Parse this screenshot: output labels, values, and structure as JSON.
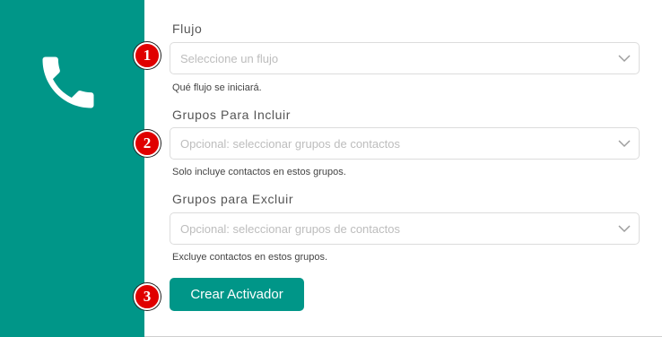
{
  "sidebar": {
    "icon": "phone-icon",
    "color": "#009688"
  },
  "form": {
    "flow": {
      "label": "Flujo",
      "placeholder": "Seleccione un flujo",
      "help": "Qué flujo se iniciará."
    },
    "include_groups": {
      "label": "Grupos Para Incluir",
      "placeholder": "Opcional: seleccionar grupos de contactos",
      "help": "Solo incluye contactos en estos grupos."
    },
    "exclude_groups": {
      "label": "Grupos para Excluir",
      "placeholder": "Opcional: seleccionar grupos de contactos",
      "help": "Excluye contactos en estos grupos."
    },
    "submit_label": "Crear Activador"
  },
  "markers": [
    "1",
    "2",
    "3"
  ],
  "colors": {
    "accent": "#009688",
    "marker": "#e00000"
  }
}
